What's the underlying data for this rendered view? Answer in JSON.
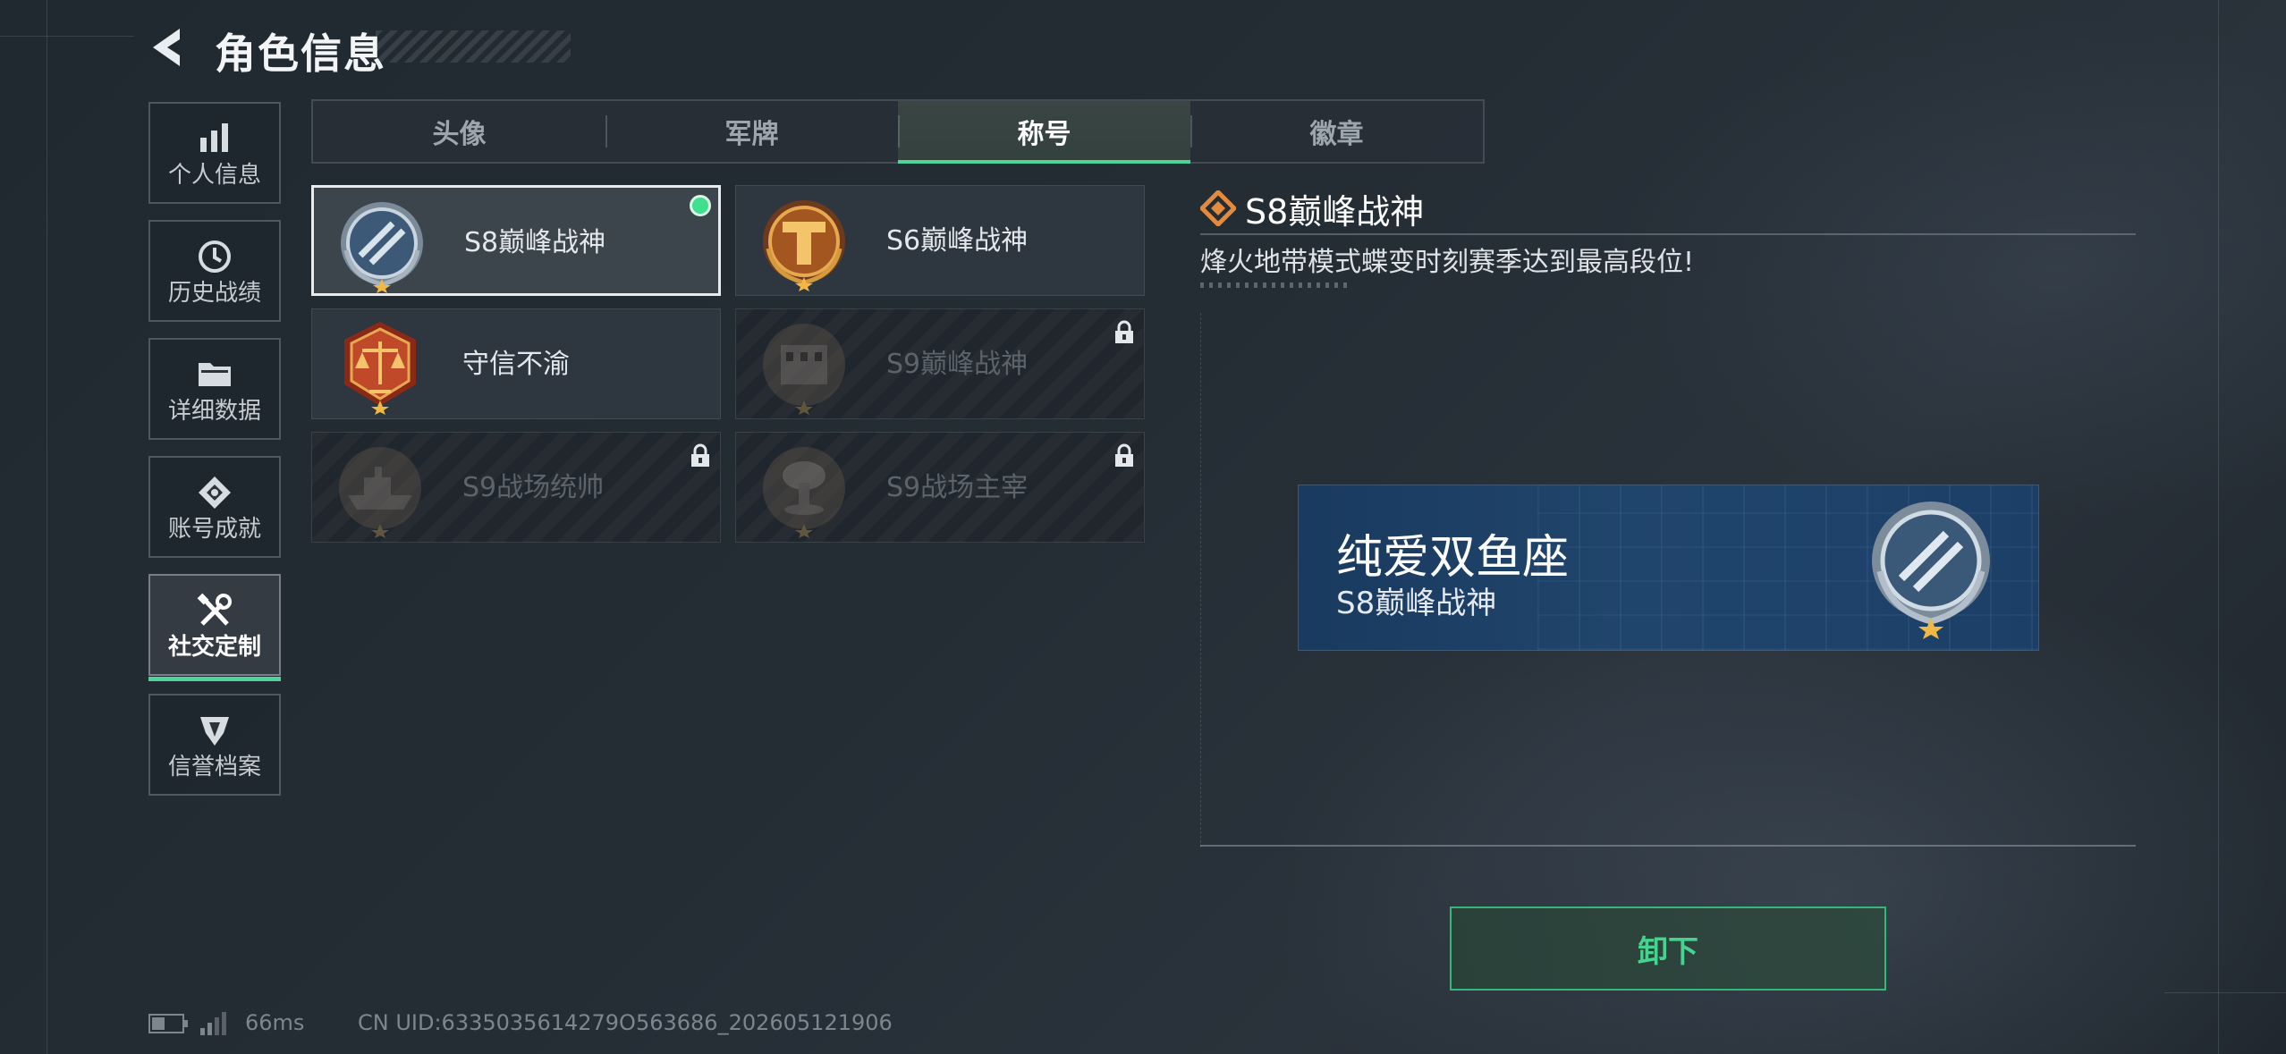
{
  "header": {
    "title": "角色信息",
    "back_icon": "back-chevron-icon"
  },
  "sidebar": {
    "items": [
      {
        "label": "个人信息",
        "icon": "bar-chart-icon",
        "active": false
      },
      {
        "label": "历史战绩",
        "icon": "clock-history-icon",
        "active": false
      },
      {
        "label": "详细数据",
        "icon": "folder-icon",
        "active": false
      },
      {
        "label": "账号成就",
        "icon": "achievement-badge-icon",
        "active": false
      },
      {
        "label": "社交定制",
        "icon": "tools-wrench-icon",
        "active": true
      },
      {
        "label": "信誉档案",
        "icon": "shield-emblem-icon",
        "active": false
      }
    ]
  },
  "tabs": [
    {
      "label": "头像",
      "active": false
    },
    {
      "label": "军牌",
      "active": false
    },
    {
      "label": "称号",
      "active": true
    },
    {
      "label": "徽章",
      "active": false
    }
  ],
  "titles": [
    {
      "name": "S8巅峰战神",
      "medal": "blue-laurel-medal-icon",
      "locked": false,
      "selected": true,
      "equipped": true
    },
    {
      "name": "S6巅峰战神",
      "medal": "bronze-t-medal-icon",
      "locked": false,
      "selected": false,
      "equipped": false
    },
    {
      "name": "守信不渝",
      "medal": "scales-justice-medal-icon",
      "locked": false,
      "selected": false,
      "equipped": false
    },
    {
      "name": "S9巅峰战神",
      "medal": "fortress-medal-icon",
      "locked": true,
      "selected": false,
      "equipped": false
    },
    {
      "name": "S9战场统帅",
      "medal": "warship-medal-icon",
      "locked": true,
      "selected": false,
      "equipped": false
    },
    {
      "name": "S9战场主宰",
      "medal": "mushroom-cloud-medal-icon",
      "locked": true,
      "selected": false,
      "equipped": false
    }
  ],
  "detail": {
    "title": "S8巅峰战神",
    "description": "烽火地带模式蝶变时刻赛季达到最高段位!",
    "preview": {
      "player_name": "纯爱双鱼座",
      "title": "S8巅峰战神"
    },
    "unequip_label": "卸下"
  },
  "status": {
    "ping": "66ms",
    "uid": "CN UID:6335035614279O563686_202605121906"
  },
  "colors": {
    "accent": "#4fd39a",
    "button_text": "#47d38f",
    "equipped_dot": "#3ee08d"
  }
}
